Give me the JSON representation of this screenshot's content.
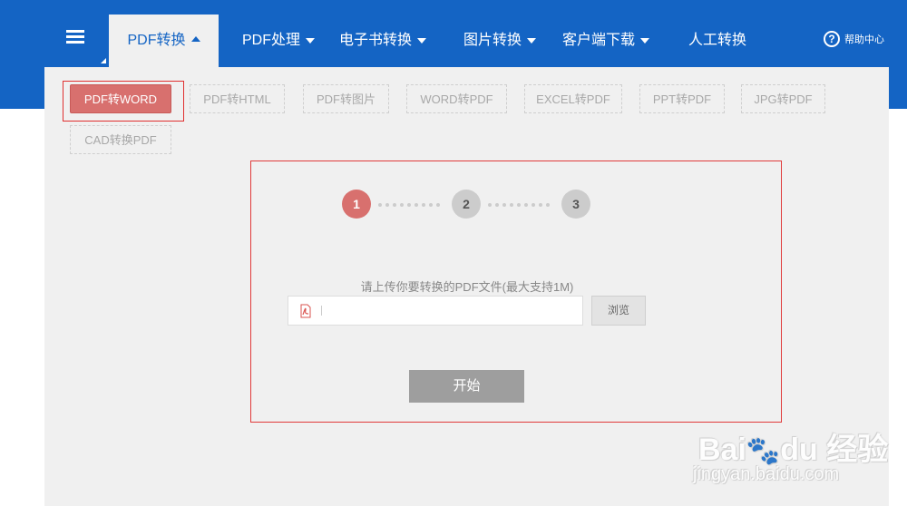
{
  "nav": {
    "tabs": [
      {
        "label": "PDF转换",
        "active": true
      },
      {
        "label": "PDF处理"
      },
      {
        "label": "电子书转换"
      },
      {
        "label": "图片转换"
      },
      {
        "label": "客户端下载"
      },
      {
        "label": "人工转换"
      }
    ],
    "help_label": "帮助中心",
    "help_icon": "?"
  },
  "options": [
    {
      "label": "PDF转WORD",
      "active": true
    },
    {
      "label": "PDF转HTML"
    },
    {
      "label": "PDF转图片"
    },
    {
      "label": "WORD转PDF"
    },
    {
      "label": "EXCEL转PDF"
    },
    {
      "label": "PPT转PDF"
    },
    {
      "label": "JPG转PDF"
    },
    {
      "label": "CAD转换PDF"
    }
  ],
  "steps": [
    "1",
    "2",
    "3"
  ],
  "upload": {
    "label": "请上传你要转换的PDF文件(最大支持1M)",
    "value": "",
    "browse_label": "浏览",
    "start_label": "开始"
  },
  "watermark": {
    "brand": "Bai",
    "brand2": "du",
    "brand_cn": "经验",
    "url": "jingyan.baidu.com"
  },
  "colors": {
    "header_blue": "#1464c4",
    "accent_red": "#d8706e",
    "highlight_border": "#e03030"
  }
}
